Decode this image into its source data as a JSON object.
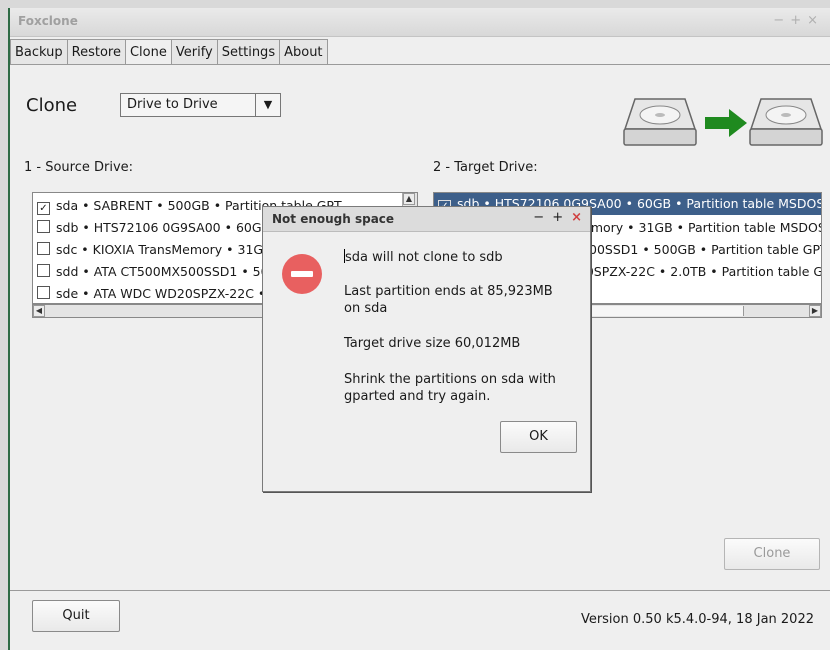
{
  "window": {
    "title": "Foxclone"
  },
  "tabs": [
    "Backup",
    "Restore",
    "Clone",
    "Verify",
    "Settings",
    "About"
  ],
  "active_tab": "Clone",
  "clone": {
    "heading": "Clone",
    "mode": "Drive to Drive",
    "source_label": "1 - Source Drive:",
    "target_label": "2 - Target Drive:",
    "source_drives": [
      {
        "text": "sda • SABRENT • 500GB • Partition table GPT",
        "checked": true
      },
      {
        "text": "sdb • HTS72106 0G9SA00 • 60GB • Partition table MSDOS",
        "checked": false
      },
      {
        "text": "sdc • KIOXIA TransMemory • 31GB • Partition table MSDOS",
        "checked": false
      },
      {
        "text": "sdd • ATA CT500MX500SSD1 • 500GB • Partition table GPT",
        "checked": false
      },
      {
        "text": "sde • ATA WDC WD20SPZX-22C • 2.0TB • Partition table GPT",
        "checked": false
      }
    ],
    "target_drives": [
      {
        "text": "sdb • HTS72106 0G9SA00 • 60GB • Partition table MSDOS",
        "checked": true
      },
      {
        "text": "sdc • KIOXIA TransMemory • 31GB • Partition table MSDOS",
        "checked": false
      },
      {
        "text": "sdd • ATA CT500MX500SSD1 • 500GB • Partition table GPT",
        "checked": false
      },
      {
        "text": "sde • ATA WDC WD20SPZX-22C • 2.0TB • Partition table GPT",
        "checked": false
      }
    ],
    "clone_button": "Clone"
  },
  "footer": {
    "quit_button": "Quit",
    "version": "Version 0.50 k5.4.0-94, 18 Jan 2022"
  },
  "dialog": {
    "title": "Not enough space",
    "line1": "sda will not clone to sdb",
    "line2a": "Last partition ends at 85,923MB",
    "line2b": "on sda",
    "line3": "Target drive size 60,012MB",
    "line4a": "Shrink the partitions on sda with",
    "line4b": "gparted and try again.",
    "ok_button": "OK",
    "icon": "error-stop-icon"
  },
  "colors": {
    "selection": "#3d5f8a",
    "error": "#e86060",
    "arrow": "#1f8a1f"
  }
}
